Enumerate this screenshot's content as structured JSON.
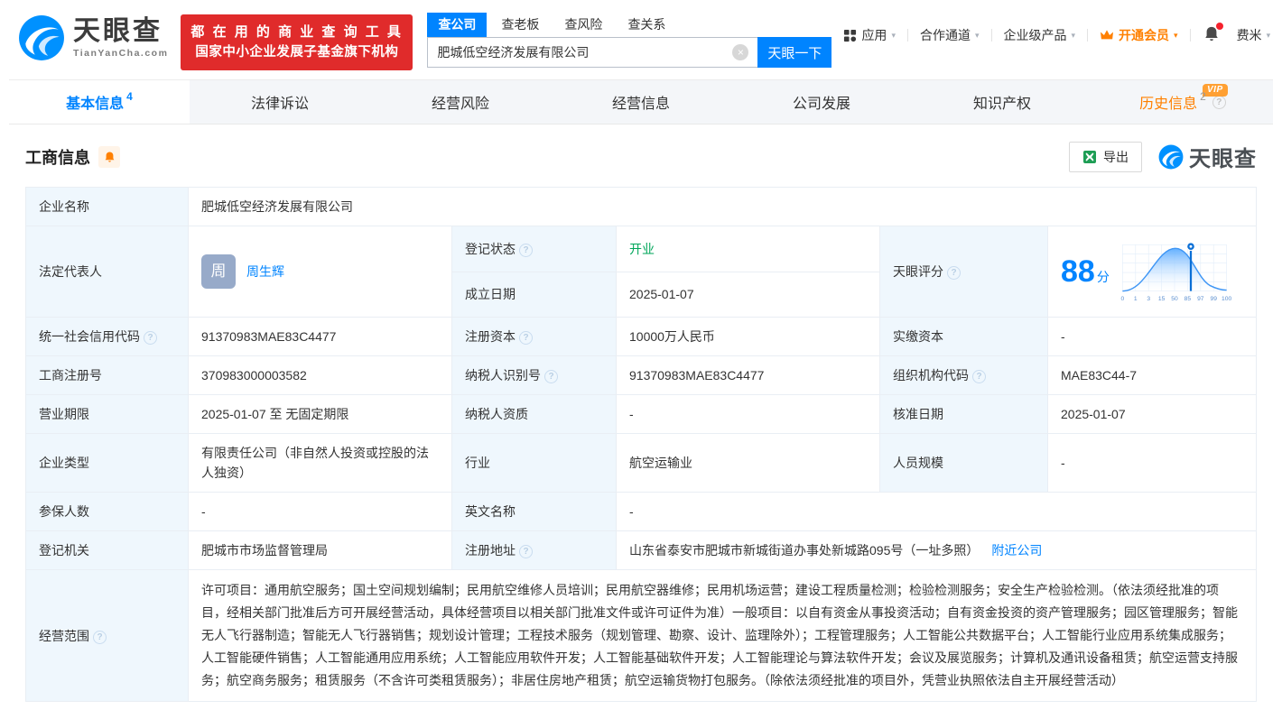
{
  "colors": {
    "accent": "#0084ff",
    "orange": "#ff8000",
    "green": "#00a65a",
    "red": "#e02b2b"
  },
  "icons": {
    "help": "?",
    "caret": "▾",
    "clear": "×"
  },
  "header": {
    "brand": {
      "name": "天眼查",
      "domain": "TianYanCha.com"
    },
    "promo": {
      "line1": "都 在 用 的 商 业 查 询 工 具",
      "line2": "国家中小企业发展子基金旗下机构"
    },
    "search": {
      "tabs": [
        {
          "label": "查公司"
        },
        {
          "label": "查老板"
        },
        {
          "label": "查风险"
        },
        {
          "label": "查关系"
        }
      ],
      "value": "肥城低空经济发展有限公司",
      "button": "天眼一下"
    },
    "nav": {
      "apps": "应用",
      "partner": "合作通道",
      "enterprise": "企业级产品",
      "vip": "开通会员",
      "user": "费米"
    }
  },
  "tabs": {
    "basic": {
      "label": "基本信息",
      "count": "4"
    },
    "legal": {
      "label": "法律诉讼"
    },
    "risk": {
      "label": "经营风险"
    },
    "operation": {
      "label": "经营信息"
    },
    "development": {
      "label": "公司发展"
    },
    "ip": {
      "label": "知识产权"
    },
    "history": {
      "label": "历史信息",
      "count": "2",
      "badge": "VIP"
    }
  },
  "section": {
    "title": "工商信息",
    "export": "导出",
    "brand": "天眼查"
  },
  "biz": {
    "company_name": {
      "label": "企业名称",
      "value": "肥城低空经济发展有限公司"
    },
    "legal_rep": {
      "label": "法定代表人",
      "avatar": "周",
      "name": "周生辉"
    },
    "reg_status": {
      "label": "登记状态",
      "value": "开业"
    },
    "establish_date": {
      "label": "成立日期",
      "value": "2025-01-07"
    },
    "score": {
      "label": "天眼评分",
      "value": "88",
      "unit": "分",
      "axis": [
        "0",
        "1",
        "3",
        "15",
        "50",
        "85",
        "97",
        "99",
        "100"
      ]
    },
    "credit_code": {
      "label": "统一社会信用代码",
      "value": "91370983MAE83C4477"
    },
    "reg_capital": {
      "label": "注册资本",
      "value": "10000万人民币"
    },
    "paid_capital": {
      "label": "实缴资本",
      "value": "-"
    },
    "reg_number": {
      "label": "工商注册号",
      "value": "370983000003582"
    },
    "taxpayer_id": {
      "label": "纳税人识别号",
      "value": "91370983MAE83C4477"
    },
    "org_code": {
      "label": "组织机构代码",
      "value": "MAE83C44-7"
    },
    "biz_term": {
      "label": "营业期限",
      "value": "2025-01-07 至 无固定期限"
    },
    "taxpayer_quality": {
      "label": "纳税人资质",
      "value": "-"
    },
    "approval_date": {
      "label": "核准日期",
      "value": "2025-01-07"
    },
    "company_type": {
      "label": "企业类型",
      "value": "有限责任公司（非自然人投资或控股的法人独资）"
    },
    "industry": {
      "label": "行业",
      "value": "航空运输业"
    },
    "staff_size": {
      "label": "人员规模",
      "value": "-"
    },
    "insured_count": {
      "label": "参保人数",
      "value": "-"
    },
    "english_name": {
      "label": "英文名称",
      "value": "-"
    },
    "reg_authority": {
      "label": "登记机关",
      "value": "肥城市市场监督管理局"
    },
    "reg_address": {
      "label": "注册地址",
      "value": "山东省泰安市肥城市新城街道办事处新城路095号（一址多照）",
      "link": "附近公司"
    },
    "biz_scope": {
      "label": "经营范围",
      "value": "许可项目：通用航空服务；国土空间规划编制；民用航空维修人员培训；民用航空器维修；民用机场运营；建设工程质量检测；检验检测服务；安全生产检验检测。（依法须经批准的项目，经相关部门批准后方可开展经营活动，具体经营项目以相关部门批准文件或许可证件为准）一般项目：以自有资金从事投资活动；自有资金投资的资产管理服务；园区管理服务；智能无人飞行器制造；智能无人飞行器销售；规划设计管理；工程技术服务（规划管理、勘察、设计、监理除外）；工程管理服务；人工智能公共数据平台；人工智能行业应用系统集成服务；人工智能硬件销售；人工智能通用应用系统；人工智能应用软件开发；人工智能基础软件开发；人工智能理论与算法软件开发；会议及展览服务；计算机及通讯设备租赁；航空运营支持服务；航空商务服务；租赁服务（不含许可类租赁服务）；非居住房地产租赁；航空运输货物打包服务。（除依法须经批准的项目外，凭营业执照依法自主开展经营活动）"
    }
  }
}
